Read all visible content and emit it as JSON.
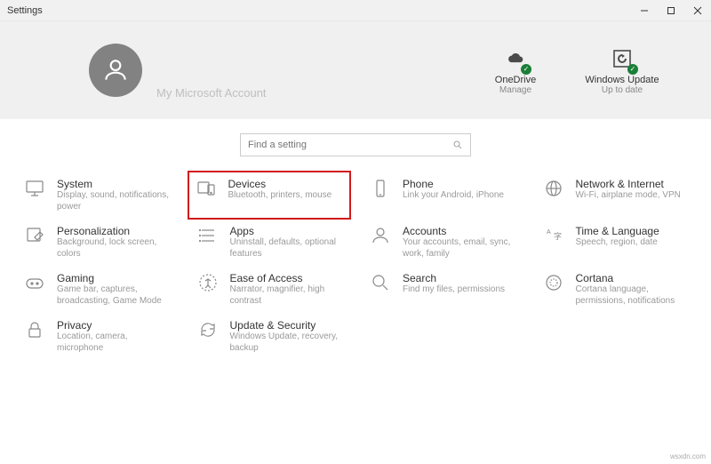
{
  "window": {
    "title": "Settings"
  },
  "account": {
    "name": "My Microsoft Account"
  },
  "statuses": {
    "onedrive": {
      "title": "OneDrive",
      "sub": "Manage"
    },
    "update": {
      "title": "Windows Update",
      "sub": "Up to date"
    }
  },
  "search": {
    "placeholder": "Find a setting"
  },
  "tiles": [
    {
      "id": "system",
      "title": "System",
      "sub": "Display, sound, notifications, power",
      "icon": "monitor-icon"
    },
    {
      "id": "devices",
      "title": "Devices",
      "sub": "Bluetooth, printers, mouse",
      "icon": "devices-icon",
      "highlight": true
    },
    {
      "id": "phone",
      "title": "Phone",
      "sub": "Link your Android, iPhone",
      "icon": "phone-icon"
    },
    {
      "id": "network",
      "title": "Network & Internet",
      "sub": "Wi-Fi, airplane mode, VPN",
      "icon": "globe-icon"
    },
    {
      "id": "personalization",
      "title": "Personalization",
      "sub": "Background, lock screen, colors",
      "icon": "paint-icon"
    },
    {
      "id": "apps",
      "title": "Apps",
      "sub": "Uninstall, defaults, optional features",
      "icon": "apps-icon"
    },
    {
      "id": "accounts",
      "title": "Accounts",
      "sub": "Your accounts, email, sync, work, family",
      "icon": "person-icon"
    },
    {
      "id": "time",
      "title": "Time & Language",
      "sub": "Speech, region, date",
      "icon": "time-icon"
    },
    {
      "id": "gaming",
      "title": "Gaming",
      "sub": "Game bar, captures, broadcasting, Game Mode",
      "icon": "gaming-icon"
    },
    {
      "id": "ease",
      "title": "Ease of Access",
      "sub": "Narrator, magnifier, high contrast",
      "icon": "ease-icon"
    },
    {
      "id": "search",
      "title": "Search",
      "sub": "Find my files, permissions",
      "icon": "search-cat-icon"
    },
    {
      "id": "cortana",
      "title": "Cortana",
      "sub": "Cortana language, permissions, notifications",
      "icon": "cortana-icon"
    },
    {
      "id": "privacy",
      "title": "Privacy",
      "sub": "Location, camera, microphone",
      "icon": "lock-icon"
    },
    {
      "id": "update",
      "title": "Update & Security",
      "sub": "Windows Update, recovery, backup",
      "icon": "sync-icon"
    }
  ],
  "watermark": "wsxdn.com"
}
